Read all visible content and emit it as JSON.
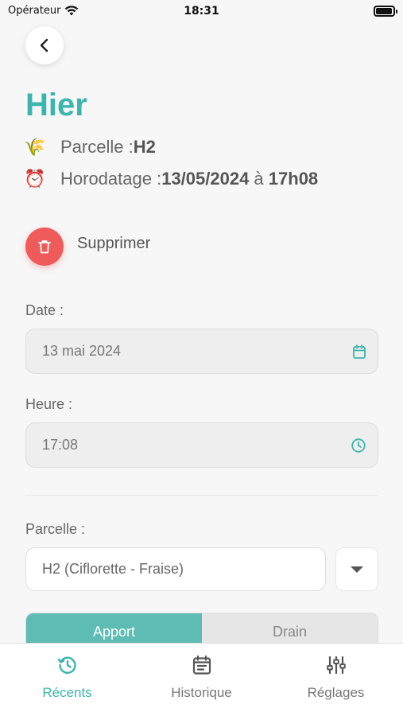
{
  "status_bar": {
    "carrier": "Opérateur",
    "time": "18:31",
    "battery_level": 0.95
  },
  "header": {
    "title": "Hier"
  },
  "meta": {
    "parcelle": {
      "icon": "rice-emoji",
      "glyph": "🌾",
      "label": "Parcelle : ",
      "value": "H2"
    },
    "horodatage": {
      "icon": "alarm-clock-emoji",
      "glyph": "⏰",
      "label": "Horodatage : ",
      "date": "13/05/2024",
      "sep": " à ",
      "time": "17h08"
    }
  },
  "delete": {
    "label": "Supprimer",
    "color": "#ef5b5b"
  },
  "form": {
    "date": {
      "label": "Date :",
      "value": "13 mai 2024"
    },
    "heure": {
      "label": "Heure :",
      "value": "17:08"
    },
    "parcelle": {
      "label": "Parcelle :",
      "value": "H2 (Ciflorette - Fraise)"
    }
  },
  "segment": {
    "options": [
      "Apport",
      "Drain"
    ],
    "selected": "Apport"
  },
  "tabs": [
    {
      "label": "Récents",
      "icon": "history-icon",
      "active": true
    },
    {
      "label": "Historique",
      "icon": "calendar-list-icon",
      "active": false
    },
    {
      "label": "Réglages",
      "icon": "sliders-icon",
      "active": false
    }
  ],
  "colors": {
    "accent": "#3bb5ad",
    "danger": "#ef5b5b",
    "segment_active": "#5dbdb4"
  }
}
